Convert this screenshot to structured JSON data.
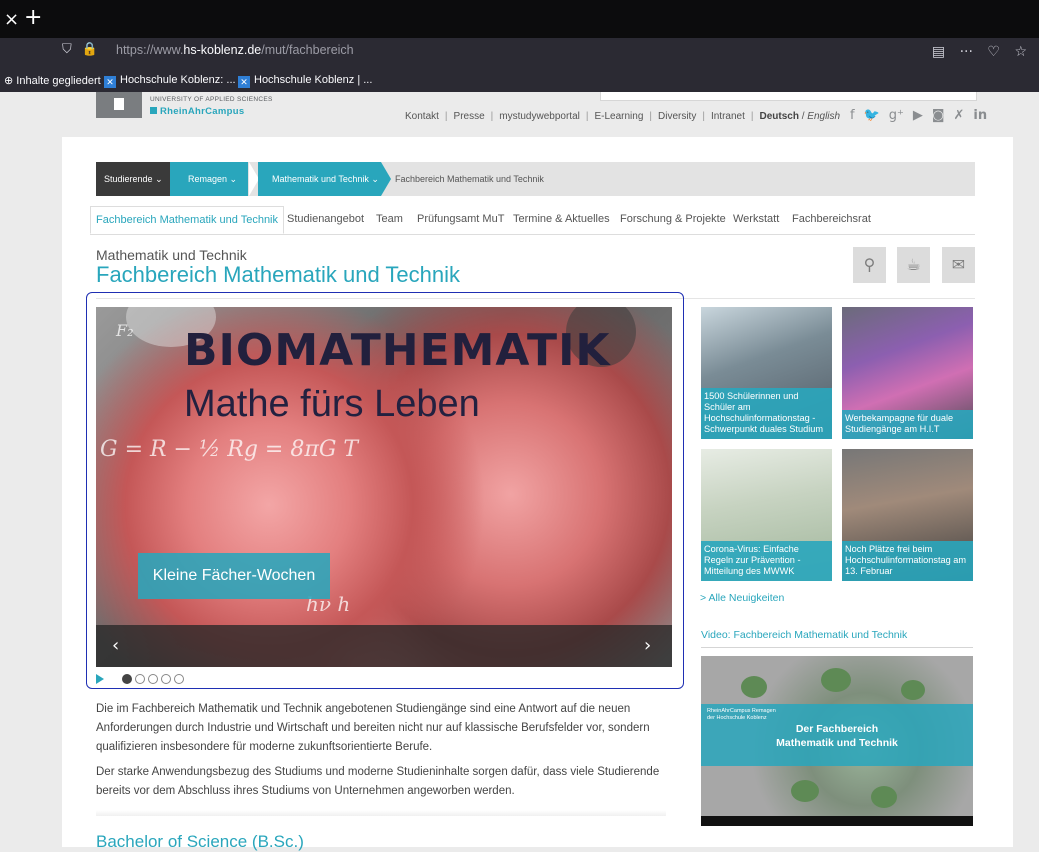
{
  "browser": {
    "tab_close": "×",
    "tab_new": "+",
    "url_prefix": "https://www.",
    "url_domain": "hs-koblenz.de",
    "url_path": "/mut/fachbereich",
    "bookmarks": [
      {
        "label": "Inhalte gegliedert"
      },
      {
        "label": "Hochschule Koblenz: ..."
      },
      {
        "label": "Hochschule Koblenz | ..."
      }
    ]
  },
  "header": {
    "logo_line1": "UNIVERSITY OF APPLIED SCIENCES",
    "logo_line2": "RheinAhrCampus",
    "topnav": [
      "Kontakt",
      "Presse",
      "mystudywebportal",
      "E-Learning",
      "Diversity",
      "Intranet"
    ],
    "lang_de": "Deutsch",
    "lang_sep": " / ",
    "lang_en": "English"
  },
  "breadcrumb": [
    {
      "label": "Studierende"
    },
    {
      "label": "Remagen"
    },
    {
      "label": "Mathematik und Technik"
    },
    {
      "label": "Fachbereich Mathematik und Technik"
    }
  ],
  "subnav": [
    "Fachbereich Mathematik und Technik",
    "Studienangebot",
    "Team",
    "Prüfungsamt MuT",
    "Termine & Aktuelles",
    "Forschung & Projekte",
    "Werkstatt",
    "Fachbereichsrat"
  ],
  "page": {
    "kicker": "Mathematik und Technik",
    "title": "Fachbereich Mathematik und Technik"
  },
  "slider": {
    "headline": "BIOMATHEMATIK",
    "subheadline": "Mathe fürs Leben",
    "tag": "Kleine Fächer-Wochen",
    "prev": "‹",
    "next": "›",
    "active_slide": 1,
    "slide_count": 5
  },
  "body": {
    "p1": "Die im Fachbereich Mathematik und Technik angebotenen Studiengänge sind eine Antwort auf die neuen Anforderungen durch Industrie und Wirtschaft und bereiten nicht nur auf klassische Berufsfelder vor, sondern qualifizieren insbesondere für moderne zukunftsorientierte Berufe.",
    "p2": "Der starke Anwendungsbezug des Studiums und moderne Studieninhalte sorgen dafür, dass viele Studierende bereits vor dem Abschluss ihres Studiums von Unternehmen angeworben werden.",
    "section_heading": "Bachelor of Science (B.Sc.)"
  },
  "news": [
    {
      "caption": "1500 Schülerinnen und Schüler am Hochschulinformationstag - Schwerpunkt duales Studium"
    },
    {
      "caption": "Werbekampagne für duale Studiengänge am H.I.T"
    },
    {
      "caption": "Corona-Virus: Einfache Regeln zur Prävention - Mitteilung des MWWK"
    },
    {
      "caption": "Noch Plätze frei beim Hochschulinformationstag am 13. Februar"
    }
  ],
  "news_more": "> Alle Neuigkeiten",
  "video": {
    "heading": "Video: Fachbereich Mathematik und Technik",
    "small": "RheinAhrCampus Remagen der Hochschule Koblenz",
    "title_line1": "Der Fachbereich",
    "title_line2": "Mathematik und Technik"
  },
  "colors": {
    "accent": "#29a6bc",
    "dark": "#3a3a3a",
    "annotation": "#1f2fb3"
  }
}
